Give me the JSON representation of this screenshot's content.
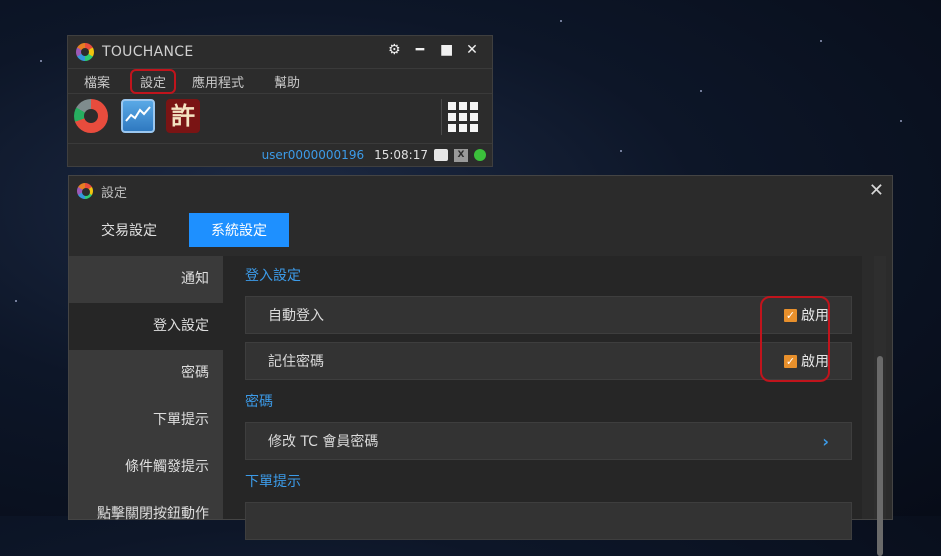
{
  "mini_window": {
    "title": "TOUCHANCE",
    "menu": [
      "檔案",
      "設定",
      "應用程式",
      "幫助"
    ],
    "toolbar_icons": [
      "portfolio-pie-icon",
      "chart-icon",
      "xu-app-icon"
    ],
    "xu_char": "許",
    "status": {
      "user": "user0000000196",
      "time": "15:08:17"
    }
  },
  "settings_window": {
    "title": "設定",
    "tabs": [
      {
        "label": "交易設定",
        "active": false
      },
      {
        "label": "系統設定",
        "active": true
      }
    ],
    "sidebar": [
      "通知",
      "登入設定",
      "密碼",
      "下單提示",
      "條件觸發提示",
      "點擊關閉按鈕動作"
    ],
    "sections": [
      {
        "title": "登入設定",
        "rows": [
          {
            "label": "自動登入",
            "check_label": "啟用",
            "checked": true
          },
          {
            "label": "記住密碼",
            "check_label": "啟用",
            "checked": true
          }
        ]
      },
      {
        "title": "密碼",
        "rows": [
          {
            "label": "修改 TC 會員密碼"
          }
        ]
      },
      {
        "title": "下單提示"
      }
    ]
  },
  "colors": {
    "accent": "#1e90ff",
    "highlight": "#c0141c",
    "checkbox": "#e8902c"
  }
}
